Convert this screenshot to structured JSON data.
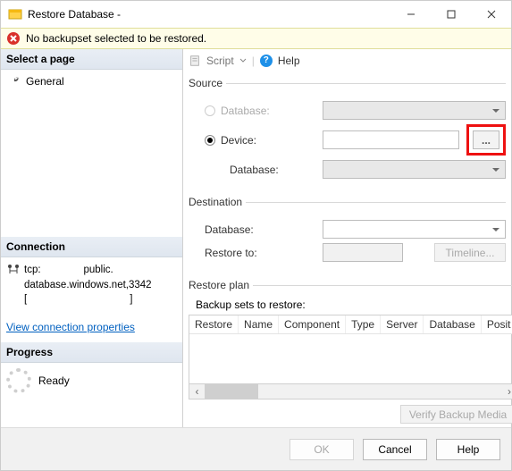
{
  "window": {
    "title": "Restore Database -"
  },
  "error": {
    "text": "No backupset selected to be restored."
  },
  "sidebar": {
    "select_page_hdr": "Select a page",
    "general_item": "General",
    "connection_hdr": "Connection",
    "conn_line1": "tcp:               public.",
    "conn_line2": "database.windows.net,3342",
    "conn_line3": "[                                    ]",
    "view_props_link": "View connection properties",
    "progress_hdr": "Progress",
    "progress_status": "Ready"
  },
  "toolbar": {
    "script": "Script",
    "help": "Help"
  },
  "source": {
    "legend": "Source",
    "database_radio": "Database:",
    "device_radio": "Device:",
    "database_sub": "Database:",
    "browse": "..."
  },
  "destination": {
    "legend": "Destination",
    "database_lbl": "Database:",
    "restoreto_lbl": "Restore to:",
    "timeline_btn": "Timeline..."
  },
  "plan": {
    "legend": "Restore plan",
    "sets_lbl": "Backup sets to restore:",
    "cols": [
      "Restore",
      "Name",
      "Component",
      "Type",
      "Server",
      "Database",
      "Posit"
    ],
    "verify_btn": "Verify Backup Media"
  },
  "footer": {
    "ok": "OK",
    "cancel": "Cancel",
    "help": "Help"
  }
}
